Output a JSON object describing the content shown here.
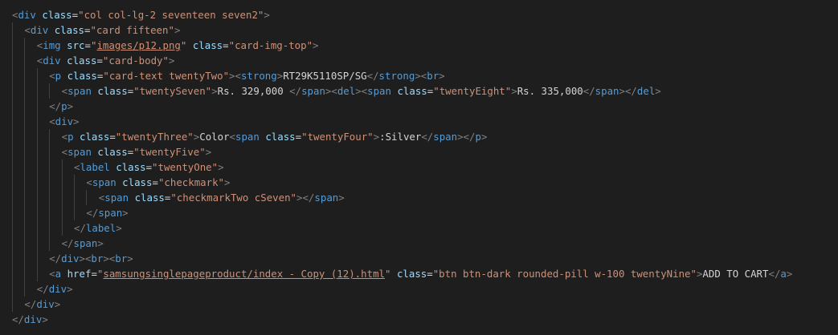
{
  "editor": {
    "language": "html",
    "theme": "dark",
    "colors": {
      "background": "#1e1e1e",
      "punctuation": "#808080",
      "tag": "#569cd6",
      "attribute": "#9cdcfe",
      "string": "#ce9178",
      "text": "#d4d4d4",
      "indent_guide": "#404040"
    },
    "lines": [
      {
        "indent": 0,
        "tokens": [
          [
            "p",
            "<"
          ],
          [
            "t",
            "div"
          ],
          [
            "x",
            " "
          ],
          [
            "a",
            "class"
          ],
          [
            "x",
            "="
          ],
          [
            "s",
            "\"col col-lg-2 seventeen seven2\""
          ],
          [
            "p",
            ">"
          ]
        ]
      },
      {
        "indent": 1,
        "tokens": [
          [
            "p",
            "<"
          ],
          [
            "t",
            "div"
          ],
          [
            "x",
            " "
          ],
          [
            "a",
            "class"
          ],
          [
            "x",
            "="
          ],
          [
            "s",
            "\"card fifteen\""
          ],
          [
            "p",
            ">"
          ]
        ]
      },
      {
        "indent": 2,
        "tokens": [
          [
            "p",
            "<"
          ],
          [
            "t",
            "img"
          ],
          [
            "x",
            " "
          ],
          [
            "a",
            "src"
          ],
          [
            "x",
            "="
          ],
          [
            "s",
            "\""
          ],
          [
            "su",
            "images/p12.png"
          ],
          [
            "s",
            "\""
          ],
          [
            "x",
            " "
          ],
          [
            "a",
            "class"
          ],
          [
            "x",
            "="
          ],
          [
            "s",
            "\"card-img-top\""
          ],
          [
            "p",
            ">"
          ]
        ]
      },
      {
        "indent": 2,
        "tokens": [
          [
            "p",
            "<"
          ],
          [
            "t",
            "div"
          ],
          [
            "x",
            " "
          ],
          [
            "a",
            "class"
          ],
          [
            "x",
            "="
          ],
          [
            "s",
            "\"card-body\""
          ],
          [
            "p",
            ">"
          ]
        ]
      },
      {
        "indent": 3,
        "tokens": [
          [
            "p",
            "<"
          ],
          [
            "t",
            "p"
          ],
          [
            "x",
            " "
          ],
          [
            "a",
            "class"
          ],
          [
            "x",
            "="
          ],
          [
            "s",
            "\"card-text twentyTwo\""
          ],
          [
            "p",
            "><"
          ],
          [
            "t",
            "strong"
          ],
          [
            "p",
            ">"
          ],
          [
            "x",
            "RT29K5110SP/SG"
          ],
          [
            "p",
            "</"
          ],
          [
            "t",
            "strong"
          ],
          [
            "p",
            "><"
          ],
          [
            "t",
            "br"
          ],
          [
            "p",
            ">"
          ]
        ]
      },
      {
        "indent": 4,
        "tokens": [
          [
            "p",
            "<"
          ],
          [
            "t",
            "span"
          ],
          [
            "x",
            " "
          ],
          [
            "a",
            "class"
          ],
          [
            "x",
            "="
          ],
          [
            "s",
            "\"twentySeven\""
          ],
          [
            "p",
            ">"
          ],
          [
            "x",
            "Rs. 329,000 "
          ],
          [
            "p",
            "</"
          ],
          [
            "t",
            "span"
          ],
          [
            "p",
            "><"
          ],
          [
            "t",
            "del"
          ],
          [
            "p",
            "><"
          ],
          [
            "t",
            "span"
          ],
          [
            "x",
            " "
          ],
          [
            "a",
            "class"
          ],
          [
            "x",
            "="
          ],
          [
            "s",
            "\"twentyEight\""
          ],
          [
            "p",
            ">"
          ],
          [
            "x",
            "Rs. 335,000"
          ],
          [
            "p",
            "</"
          ],
          [
            "t",
            "span"
          ],
          [
            "p",
            "></"
          ],
          [
            "t",
            "del"
          ],
          [
            "p",
            ">"
          ]
        ]
      },
      {
        "indent": 3,
        "tokens": [
          [
            "p",
            "</"
          ],
          [
            "t",
            "p"
          ],
          [
            "p",
            ">"
          ]
        ]
      },
      {
        "indent": 3,
        "tokens": [
          [
            "p",
            "<"
          ],
          [
            "t",
            "div"
          ],
          [
            "p",
            ">"
          ]
        ]
      },
      {
        "indent": 4,
        "tokens": [
          [
            "p",
            "<"
          ],
          [
            "t",
            "p"
          ],
          [
            "x",
            " "
          ],
          [
            "a",
            "class"
          ],
          [
            "x",
            "="
          ],
          [
            "s",
            "\"twentyThree\""
          ],
          [
            "p",
            ">"
          ],
          [
            "x",
            "Color"
          ],
          [
            "p",
            "<"
          ],
          [
            "t",
            "span"
          ],
          [
            "x",
            " "
          ],
          [
            "a",
            "class"
          ],
          [
            "x",
            "="
          ],
          [
            "s",
            "\"twentyFour\""
          ],
          [
            "p",
            ">"
          ],
          [
            "x",
            ":Silver"
          ],
          [
            "p",
            "</"
          ],
          [
            "t",
            "span"
          ],
          [
            "p",
            "></"
          ],
          [
            "t",
            "p"
          ],
          [
            "p",
            ">"
          ]
        ]
      },
      {
        "indent": 4,
        "tokens": [
          [
            "p",
            "<"
          ],
          [
            "t",
            "span"
          ],
          [
            "x",
            " "
          ],
          [
            "a",
            "class"
          ],
          [
            "x",
            "="
          ],
          [
            "s",
            "\"twentyFive\""
          ],
          [
            "p",
            ">"
          ]
        ]
      },
      {
        "indent": 5,
        "tokens": [
          [
            "p",
            "<"
          ],
          [
            "t",
            "label"
          ],
          [
            "x",
            " "
          ],
          [
            "a",
            "class"
          ],
          [
            "x",
            "="
          ],
          [
            "s",
            "\"twentyOne\""
          ],
          [
            "p",
            ">"
          ]
        ]
      },
      {
        "indent": 6,
        "tokens": [
          [
            "p",
            "<"
          ],
          [
            "t",
            "span"
          ],
          [
            "x",
            " "
          ],
          [
            "a",
            "class"
          ],
          [
            "x",
            "="
          ],
          [
            "s",
            "\"checkmark\""
          ],
          [
            "p",
            ">"
          ]
        ]
      },
      {
        "indent": 7,
        "tokens": [
          [
            "p",
            "<"
          ],
          [
            "t",
            "span"
          ],
          [
            "x",
            " "
          ],
          [
            "a",
            "class"
          ],
          [
            "x",
            "="
          ],
          [
            "s",
            "\"checkmarkTwo cSeven\""
          ],
          [
            "p",
            "></"
          ],
          [
            "t",
            "span"
          ],
          [
            "p",
            ">"
          ]
        ]
      },
      {
        "indent": 6,
        "tokens": [
          [
            "p",
            "</"
          ],
          [
            "t",
            "span"
          ],
          [
            "p",
            ">"
          ]
        ]
      },
      {
        "indent": 5,
        "tokens": [
          [
            "p",
            "</"
          ],
          [
            "t",
            "label"
          ],
          [
            "p",
            ">"
          ]
        ]
      },
      {
        "indent": 4,
        "tokens": [
          [
            "p",
            "</"
          ],
          [
            "t",
            "span"
          ],
          [
            "p",
            ">"
          ]
        ]
      },
      {
        "indent": 3,
        "tokens": [
          [
            "p",
            "</"
          ],
          [
            "t",
            "div"
          ],
          [
            "p",
            "><"
          ],
          [
            "t",
            "br"
          ],
          [
            "p",
            "><"
          ],
          [
            "t",
            "br"
          ],
          [
            "p",
            ">"
          ]
        ]
      },
      {
        "indent": 3,
        "tokens": [
          [
            "p",
            "<"
          ],
          [
            "t",
            "a"
          ],
          [
            "x",
            " "
          ],
          [
            "a",
            "href"
          ],
          [
            "x",
            "="
          ],
          [
            "s",
            "\""
          ],
          [
            "su",
            "samsungsinglepageproduct/index - Copy (12).html"
          ],
          [
            "s",
            "\""
          ],
          [
            "x",
            " "
          ],
          [
            "a",
            "class"
          ],
          [
            "x",
            "="
          ],
          [
            "s",
            "\"btn btn-dark rounded-pill w-100 twentyNine\""
          ],
          [
            "p",
            ">"
          ],
          [
            "x",
            "ADD TO CART"
          ],
          [
            "p",
            "</"
          ],
          [
            "t",
            "a"
          ],
          [
            "p",
            ">"
          ]
        ]
      },
      {
        "indent": 2,
        "tokens": [
          [
            "p",
            "</"
          ],
          [
            "t",
            "div"
          ],
          [
            "p",
            ">"
          ]
        ]
      },
      {
        "indent": 1,
        "tokens": [
          [
            "p",
            "</"
          ],
          [
            "t",
            "div"
          ],
          [
            "p",
            ">"
          ]
        ]
      },
      {
        "indent": 0,
        "tokens": [
          [
            "p",
            "</"
          ],
          [
            "t",
            "div"
          ],
          [
            "p",
            ">"
          ]
        ]
      }
    ]
  }
}
